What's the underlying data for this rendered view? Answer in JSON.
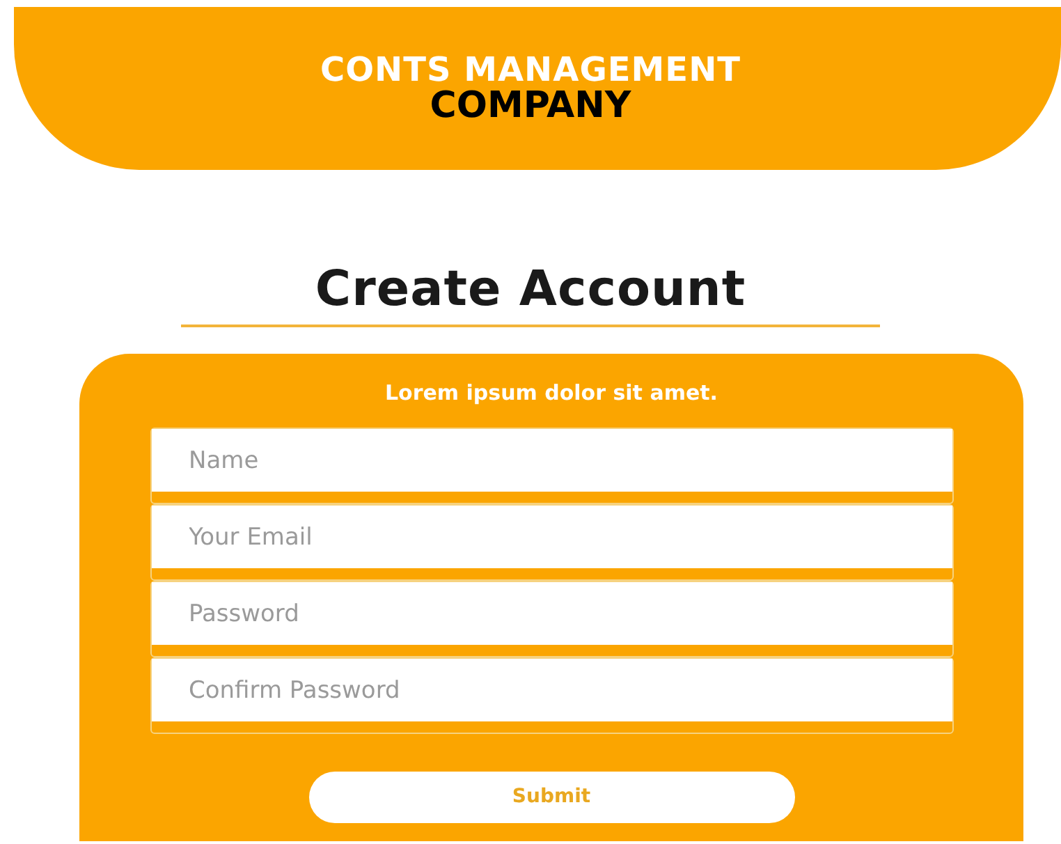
{
  "header": {
    "line_1": "CONTS MANAGEMENT",
    "line_2": "COMPANY"
  },
  "heading": "Create Account",
  "form": {
    "subtitle": "Lorem ipsum dolor sit amet.",
    "fields": [
      {
        "placeholder": "Name"
      },
      {
        "placeholder": "Your Email"
      },
      {
        "placeholder": "Password"
      },
      {
        "placeholder": "Confirm Password"
      }
    ],
    "submit": "Submit"
  }
}
